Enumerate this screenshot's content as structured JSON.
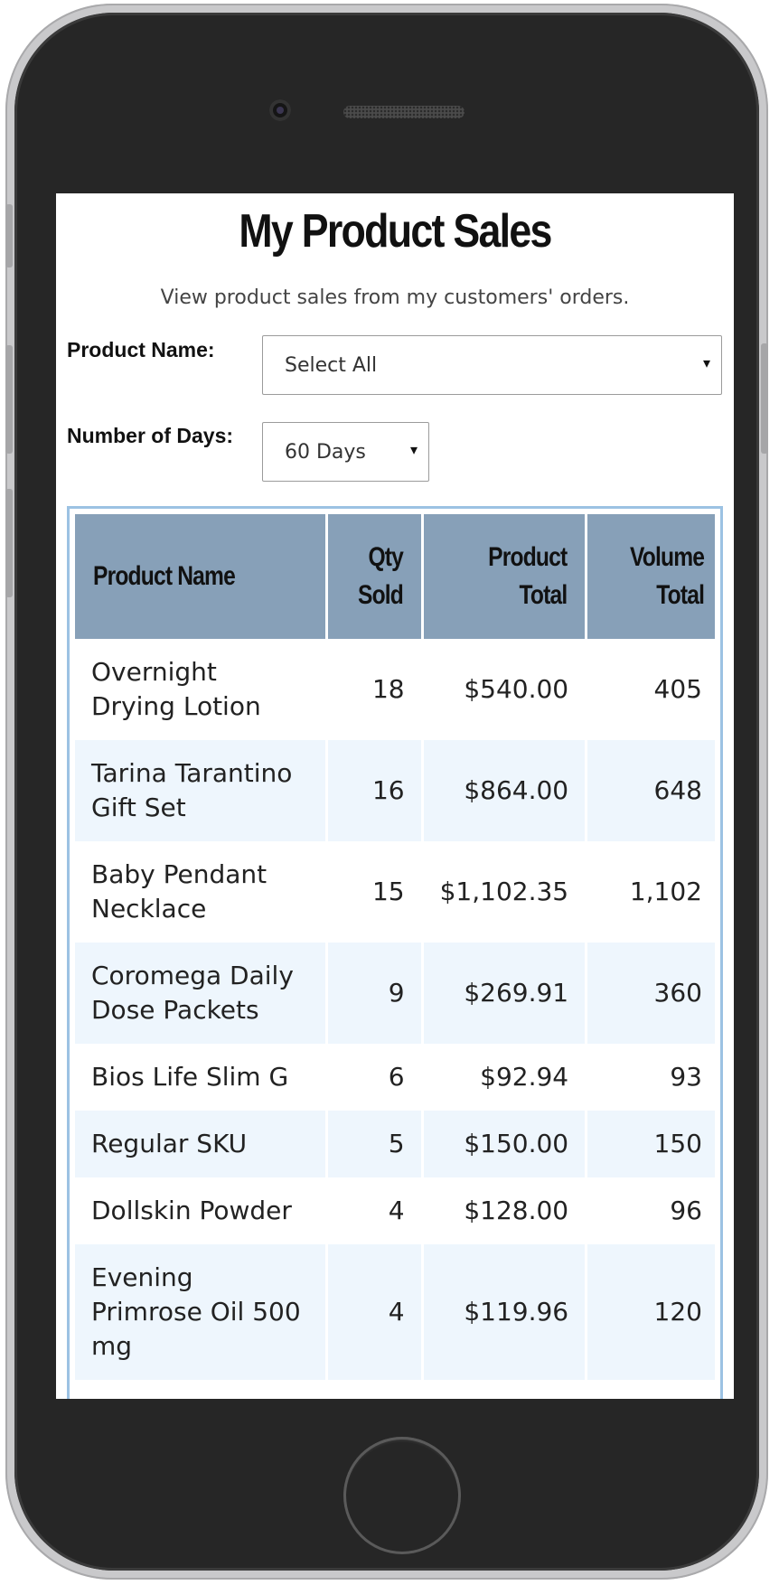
{
  "page": {
    "title": "My Product Sales",
    "subtitle": "View product sales from my customers' orders."
  },
  "filters": {
    "product_name": {
      "label": "Product Name:",
      "value": "Select All"
    },
    "number_of_days": {
      "label": "Number of Days:",
      "value": "60 Days"
    }
  },
  "table": {
    "headers": {
      "product_name": "Product Name",
      "qty_sold_line1": "Qty",
      "qty_sold_line2": "Sold",
      "product_total_line1": "Product",
      "product_total_line2": "Total",
      "volume_total_line1": "Volume",
      "volume_total_line2": "Total"
    },
    "rows": [
      {
        "name": "Overnight Drying Lotion",
        "qty": "18",
        "total": "$540.00",
        "volume": "405"
      },
      {
        "name": "Tarina Tarantino Gift Set",
        "qty": "16",
        "total": "$864.00",
        "volume": "648"
      },
      {
        "name": "Baby Pendant Necklace",
        "qty": "15",
        "total": "$1,102.35",
        "volume": "1,102"
      },
      {
        "name": "Coromega Daily Dose Packets",
        "qty": "9",
        "total": "$269.91",
        "volume": "360"
      },
      {
        "name": "Bios Life Slim G",
        "qty": "6",
        "total": "$92.94",
        "volume": "93"
      },
      {
        "name": "Regular SKU",
        "qty": "5",
        "total": "$150.00",
        "volume": "150"
      },
      {
        "name": "Dollskin Powder",
        "qty": "4",
        "total": "$128.00",
        "volume": "96"
      },
      {
        "name": "Evening Primrose Oil 500 mg",
        "qty": "4",
        "total": "$119.96",
        "volume": "120"
      }
    ]
  },
  "icons": {
    "select_caret": "▾"
  },
  "colors": {
    "header_bg": "#87a0b8",
    "row_alt_bg": "#eef6fd",
    "table_border": "#9cc2e3",
    "phone_body": "#262626"
  }
}
